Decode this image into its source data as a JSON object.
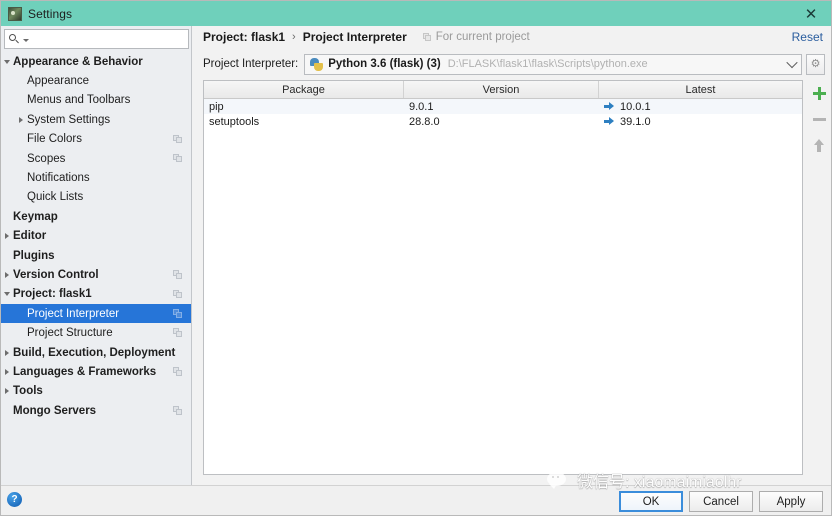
{
  "window": {
    "title": "Settings",
    "icon": "settings-app-icon",
    "close_label": "✕",
    "titlebar_color": "#6fd0bb"
  },
  "search": {
    "value": "",
    "placeholder": "",
    "icon": "search-icon"
  },
  "sidebar": {
    "items": [
      {
        "label": "Appearance & Behavior",
        "indent": 0,
        "bold": true,
        "arrow": "down",
        "copy": false,
        "selected": false
      },
      {
        "label": "Appearance",
        "indent": 1,
        "bold": false,
        "arrow": "none",
        "copy": false,
        "selected": false
      },
      {
        "label": "Menus and Toolbars",
        "indent": 1,
        "bold": false,
        "arrow": "none",
        "copy": false,
        "selected": false
      },
      {
        "label": "System Settings",
        "indent": 1,
        "bold": false,
        "arrow": "right",
        "copy": false,
        "selected": false
      },
      {
        "label": "File Colors",
        "indent": 1,
        "bold": false,
        "arrow": "none",
        "copy": true,
        "selected": false
      },
      {
        "label": "Scopes",
        "indent": 1,
        "bold": false,
        "arrow": "none",
        "copy": true,
        "selected": false
      },
      {
        "label": "Notifications",
        "indent": 1,
        "bold": false,
        "arrow": "none",
        "copy": false,
        "selected": false
      },
      {
        "label": "Quick Lists",
        "indent": 1,
        "bold": false,
        "arrow": "none",
        "copy": false,
        "selected": false
      },
      {
        "label": "Keymap",
        "indent": 0,
        "bold": true,
        "arrow": "none",
        "copy": false,
        "selected": false
      },
      {
        "label": "Editor",
        "indent": 0,
        "bold": true,
        "arrow": "right",
        "copy": false,
        "selected": false
      },
      {
        "label": "Plugins",
        "indent": 0,
        "bold": true,
        "arrow": "none",
        "copy": false,
        "selected": false
      },
      {
        "label": "Version Control",
        "indent": 0,
        "bold": true,
        "arrow": "right",
        "copy": true,
        "selected": false
      },
      {
        "label": "Project: flask1",
        "indent": 0,
        "bold": true,
        "arrow": "down",
        "copy": true,
        "selected": false
      },
      {
        "label": "Project Interpreter",
        "indent": 1,
        "bold": false,
        "arrow": "none",
        "copy": true,
        "selected": true
      },
      {
        "label": "Project Structure",
        "indent": 1,
        "bold": false,
        "arrow": "none",
        "copy": true,
        "selected": false
      },
      {
        "label": "Build, Execution, Deployment",
        "indent": 0,
        "bold": true,
        "arrow": "right",
        "copy": false,
        "selected": false
      },
      {
        "label": "Languages & Frameworks",
        "indent": 0,
        "bold": true,
        "arrow": "right",
        "copy": true,
        "selected": false
      },
      {
        "label": "Tools",
        "indent": 0,
        "bold": true,
        "arrow": "right",
        "copy": false,
        "selected": false
      },
      {
        "label": "Mongo Servers",
        "indent": 0,
        "bold": true,
        "arrow": "none",
        "copy": true,
        "selected": false
      }
    ],
    "selected_color": "#2675d8"
  },
  "breadcrumb": {
    "root": "Project: flask1",
    "separator": "›",
    "current": "Project Interpreter",
    "scope_note": "For current project",
    "reset_label": "Reset",
    "reset_color": "#2a5d9e"
  },
  "interpreter": {
    "label": "Project Interpreter:",
    "name": "Python 3.6 (flask) (3)",
    "path": "D:\\FLASK\\flask1\\flask\\Scripts\\python.exe",
    "icon": "python-icon",
    "dropdown_icon": "chevron-down-icon",
    "gear_icon": "gear-icon",
    "gear_glyph": "⚙"
  },
  "packages": {
    "columns": [
      "Package",
      "Version",
      "Latest"
    ],
    "rows": [
      {
        "package": "pip",
        "version": "9.0.1",
        "latest": "10.0.1",
        "upgradable": true
      },
      {
        "package": "setuptools",
        "version": "28.8.0",
        "latest": "39.1.0",
        "upgradable": true
      }
    ],
    "upgrade_arrow_color": "#2d7fc1"
  },
  "side_tools": [
    {
      "name": "add-package-button",
      "icon": "plus-icon",
      "color": "#4caf50"
    },
    {
      "name": "remove-package-button",
      "icon": "minus-icon",
      "color": "#b4b4b4"
    },
    {
      "name": "upgrade-package-button",
      "icon": "up-arrow-icon",
      "color": "#b4b4b4"
    }
  ],
  "footer": {
    "help_glyph": "?",
    "buttons": [
      {
        "label": "OK",
        "default": true
      },
      {
        "label": "Cancel",
        "default": false
      },
      {
        "label": "Apply",
        "default": false
      }
    ]
  },
  "watermark": {
    "text": "微信号: xiaomaimiaolhr",
    "icon": "wechat-icon"
  }
}
